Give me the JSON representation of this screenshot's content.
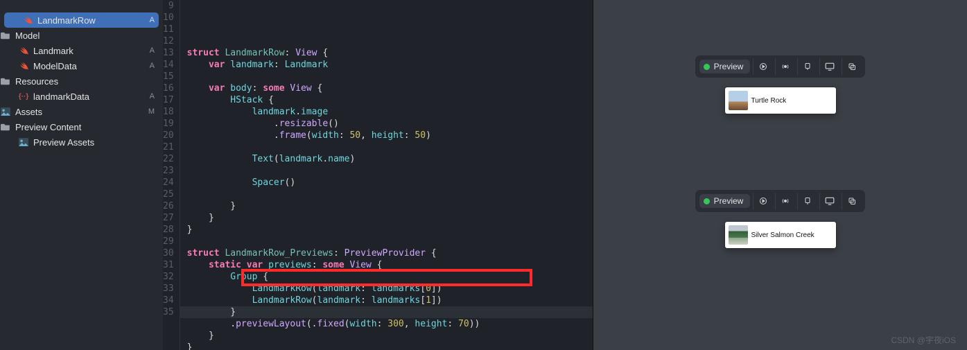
{
  "navigator": {
    "items": [
      {
        "label": "LandmarkRow",
        "icon": "swift",
        "indent": 1,
        "active": true,
        "badge": "A"
      },
      {
        "label": "Model",
        "icon": "folder",
        "indent": 0,
        "badge": ""
      },
      {
        "label": "Landmark",
        "icon": "swift",
        "indent": 1,
        "badge": "A"
      },
      {
        "label": "ModelData",
        "icon": "swift",
        "indent": 1,
        "badge": "A"
      },
      {
        "label": "Resources",
        "icon": "folder",
        "indent": 0,
        "badge": ""
      },
      {
        "label": "landmarkData",
        "icon": "json",
        "indent": 1,
        "badge": "A"
      },
      {
        "label": "Assets",
        "icon": "assets",
        "indent": 0,
        "badge": "M"
      },
      {
        "label": "Preview Content",
        "icon": "folder",
        "indent": 0,
        "badge": ""
      },
      {
        "label": "Preview Assets",
        "icon": "assets",
        "indent": 1,
        "badge": ""
      }
    ]
  },
  "editor": {
    "first_line": 9,
    "highlighted_line": 32,
    "tokens": [
      [],
      [
        [
          "kw",
          "struct"
        ],
        [
          "punct",
          " "
        ],
        [
          "decl",
          "LandmarkRow"
        ],
        [
          "punct",
          ": "
        ],
        [
          "type2",
          "View"
        ],
        [
          "punct",
          " {"
        ]
      ],
      [
        [
          "punct",
          "    "
        ],
        [
          "kw",
          "var"
        ],
        [
          "punct",
          " "
        ],
        [
          "prop",
          "landmark"
        ],
        [
          "punct",
          ": "
        ],
        [
          "type",
          "Landmark"
        ]
      ],
      [],
      [
        [
          "punct",
          "    "
        ],
        [
          "kw",
          "var"
        ],
        [
          "punct",
          " "
        ],
        [
          "prop",
          "body"
        ],
        [
          "punct",
          ": "
        ],
        [
          "kw",
          "some"
        ],
        [
          "punct",
          " "
        ],
        [
          "type2",
          "View"
        ],
        [
          "punct",
          " {"
        ]
      ],
      [
        [
          "punct",
          "        "
        ],
        [
          "type",
          "HStack"
        ],
        [
          "punct",
          " {"
        ]
      ],
      [
        [
          "punct",
          "            "
        ],
        [
          "prop",
          "landmark"
        ],
        [
          "punct",
          "."
        ],
        [
          "prop",
          "image"
        ]
      ],
      [
        [
          "punct",
          "                ."
        ],
        [
          "method",
          "resizable"
        ],
        [
          "punct",
          "()"
        ]
      ],
      [
        [
          "punct",
          "                ."
        ],
        [
          "method",
          "frame"
        ],
        [
          "punct",
          "("
        ],
        [
          "prop",
          "width"
        ],
        [
          "punct",
          ": "
        ],
        [
          "num",
          "50"
        ],
        [
          "punct",
          ", "
        ],
        [
          "prop",
          "height"
        ],
        [
          "punct",
          ": "
        ],
        [
          "num",
          "50"
        ],
        [
          "punct",
          ")"
        ]
      ],
      [],
      [
        [
          "punct",
          "            "
        ],
        [
          "type",
          "Text"
        ],
        [
          "punct",
          "("
        ],
        [
          "prop",
          "landmark"
        ],
        [
          "punct",
          "."
        ],
        [
          "prop",
          "name"
        ],
        [
          "punct",
          ")"
        ]
      ],
      [],
      [
        [
          "punct",
          "            "
        ],
        [
          "type",
          "Spacer"
        ],
        [
          "punct",
          "()"
        ]
      ],
      [],
      [
        [
          "punct",
          "        }"
        ]
      ],
      [
        [
          "punct",
          "    }"
        ]
      ],
      [
        [
          "punct",
          "}"
        ]
      ],
      [],
      [
        [
          "kw",
          "struct"
        ],
        [
          "punct",
          " "
        ],
        [
          "decl",
          "LandmarkRow_Previews"
        ],
        [
          "punct",
          ": "
        ],
        [
          "type2",
          "PreviewProvider"
        ],
        [
          "punct",
          " {"
        ]
      ],
      [
        [
          "punct",
          "    "
        ],
        [
          "kw",
          "static"
        ],
        [
          "punct",
          " "
        ],
        [
          "kw",
          "var"
        ],
        [
          "punct",
          " "
        ],
        [
          "prop",
          "previews"
        ],
        [
          "punct",
          ": "
        ],
        [
          "kw",
          "some"
        ],
        [
          "punct",
          " "
        ],
        [
          "type2",
          "View"
        ],
        [
          "punct",
          " {"
        ]
      ],
      [
        [
          "punct",
          "        "
        ],
        [
          "type",
          "Group"
        ],
        [
          "punct",
          " {"
        ]
      ],
      [
        [
          "punct",
          "            "
        ],
        [
          "type",
          "LandmarkRow"
        ],
        [
          "punct",
          "("
        ],
        [
          "prop",
          "landmark"
        ],
        [
          "punct",
          ": "
        ],
        [
          "prop",
          "landmarks"
        ],
        [
          "punct",
          "["
        ],
        [
          "num",
          "0"
        ],
        [
          "punct",
          "])"
        ]
      ],
      [
        [
          "punct",
          "            "
        ],
        [
          "type",
          "LandmarkRow"
        ],
        [
          "punct",
          "("
        ],
        [
          "prop",
          "landmark"
        ],
        [
          "punct",
          ": "
        ],
        [
          "prop",
          "landmarks"
        ],
        [
          "punct",
          "["
        ],
        [
          "num",
          "1"
        ],
        [
          "punct",
          "])"
        ]
      ],
      [
        [
          "punct",
          "        }"
        ]
      ],
      [
        [
          "punct",
          "        ."
        ],
        [
          "method",
          "previewLayout"
        ],
        [
          "punct",
          "(."
        ],
        [
          "method",
          "fixed"
        ],
        [
          "punct",
          "("
        ],
        [
          "prop",
          "width"
        ],
        [
          "punct",
          ": "
        ],
        [
          "num",
          "300"
        ],
        [
          "punct",
          ", "
        ],
        [
          "prop",
          "height"
        ],
        [
          "punct",
          ": "
        ],
        [
          "num",
          "70"
        ],
        [
          "punct",
          "))"
        ]
      ],
      [
        [
          "punct",
          "    }"
        ]
      ],
      [
        [
          "punct",
          "}"
        ]
      ]
    ]
  },
  "previews": [
    {
      "chip_label": "Preview",
      "card_label": "Turtle Rock",
      "thumb": "rock"
    },
    {
      "chip_label": "Preview",
      "card_label": "Silver Salmon Creek",
      "thumb": "creek"
    }
  ],
  "watermark": "CSDN @宇夜iOS"
}
